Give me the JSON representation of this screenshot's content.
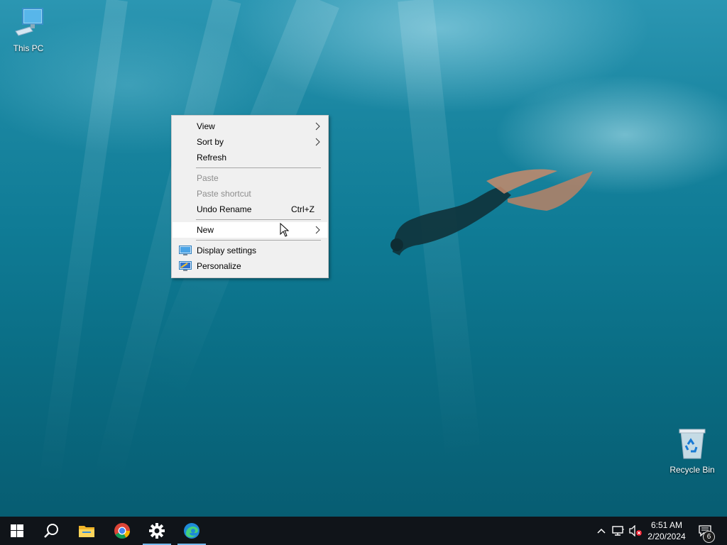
{
  "desktop": {
    "icons": [
      {
        "label": "This PC",
        "icon": "this-pc-icon"
      },
      {
        "label": "Recycle Bin",
        "icon": "recycle-bin-icon"
      }
    ]
  },
  "context_menu": {
    "items": [
      {
        "label": "View",
        "has_submenu": true
      },
      {
        "label": "Sort by",
        "has_submenu": true
      },
      {
        "label": "Refresh"
      },
      {
        "label": "Paste",
        "disabled": true
      },
      {
        "label": "Paste shortcut",
        "disabled": true
      },
      {
        "label": "Undo Rename",
        "shortcut": "Ctrl+Z"
      },
      {
        "label": "New",
        "has_submenu": true,
        "hovered": true
      },
      {
        "label": "Display settings",
        "icon": "display-settings-icon"
      },
      {
        "label": "Personalize",
        "icon": "personalize-icon"
      }
    ],
    "submenu_arrow": ">"
  },
  "taskbar": {
    "pinned": [
      {
        "name": "start",
        "icon": "windows-logo-icon"
      },
      {
        "name": "search",
        "icon": "search-icon"
      },
      {
        "name": "file-explorer",
        "icon": "folder-icon"
      },
      {
        "name": "chrome",
        "icon": "chrome-icon"
      },
      {
        "name": "settings",
        "icon": "gear-icon",
        "active": true
      },
      {
        "name": "edge",
        "icon": "edge-icon",
        "active": true
      }
    ],
    "tray": {
      "chevron": "^",
      "network_icon": "network-icon",
      "volume_icon": "volume-muted-icon"
    },
    "clock": {
      "time": "6:51 AM",
      "date": "2/20/2024"
    },
    "notifications_count": "6"
  },
  "colors": {
    "taskbar": "#101419",
    "menu_bg": "#f0f0f0",
    "active_indicator": "#76b9ed",
    "disabled_text": "#8d8d8d"
  }
}
